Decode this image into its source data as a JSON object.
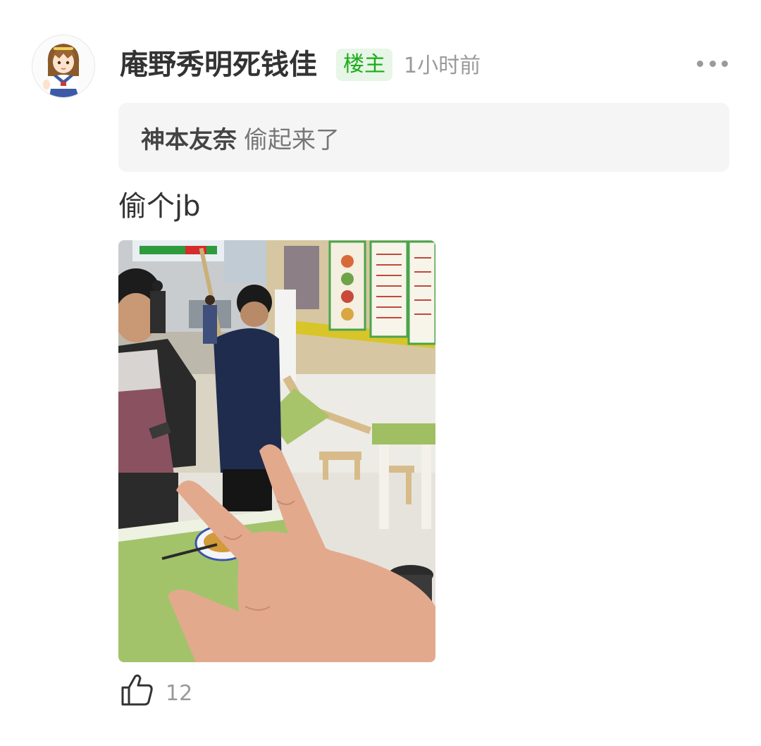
{
  "post": {
    "author": {
      "name": "庵野秀明死钱佳",
      "avatar_icon": "anime-girl-avatar-icon"
    },
    "badge": {
      "label": "楼主",
      "text_color": "#1aad19",
      "background": "#e7f6e7"
    },
    "time_ago": "1小时前",
    "more_icon": "more-dots-icon",
    "quote": {
      "author": "神本友奈",
      "text": "偷起来了"
    },
    "content": "偷个jb",
    "photo": {
      "description_icon": "restaurant-peace-sign-photo"
    },
    "likes": {
      "icon": "thumbs-up-icon",
      "count": "12"
    }
  }
}
